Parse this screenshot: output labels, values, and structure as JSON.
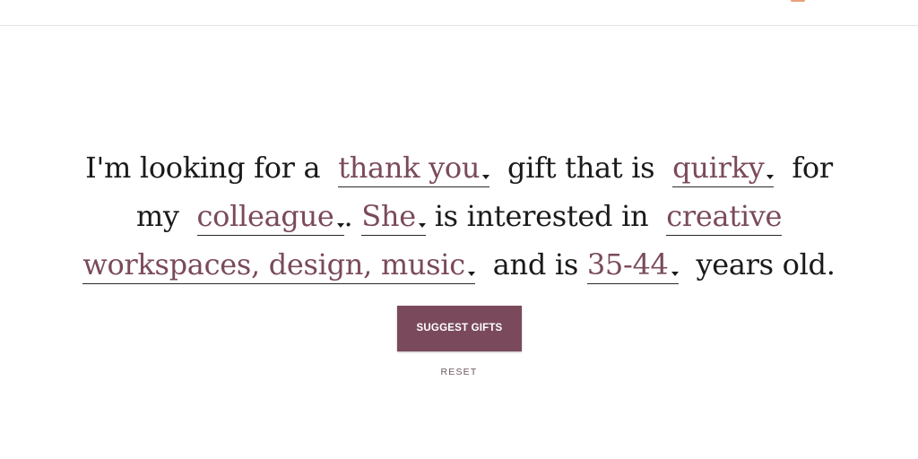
{
  "sentence": {
    "t1": "I'm looking for a",
    "occasion": "thank you",
    "t2": "gift that is",
    "style": "quirky",
    "t3": "for",
    "t4": "my",
    "relation": "colleague",
    "t5": ".",
    "pronoun": "She",
    "t6": "is interested in",
    "interests_part1": "creative",
    "interests_part2": "workspaces, design, music",
    "t7": "and is",
    "age": "35-44",
    "t8": "years old."
  },
  "actions": {
    "suggest_label": "SUGGEST GIFTS",
    "reset_label": "RESET"
  },
  "colors": {
    "accent": "#7a4a5c",
    "text": "#1a1a1a",
    "icon": "#e9a27a"
  },
  "icons": {
    "top_icon": "bag-icon",
    "dropdown": "caret-down-icon"
  }
}
